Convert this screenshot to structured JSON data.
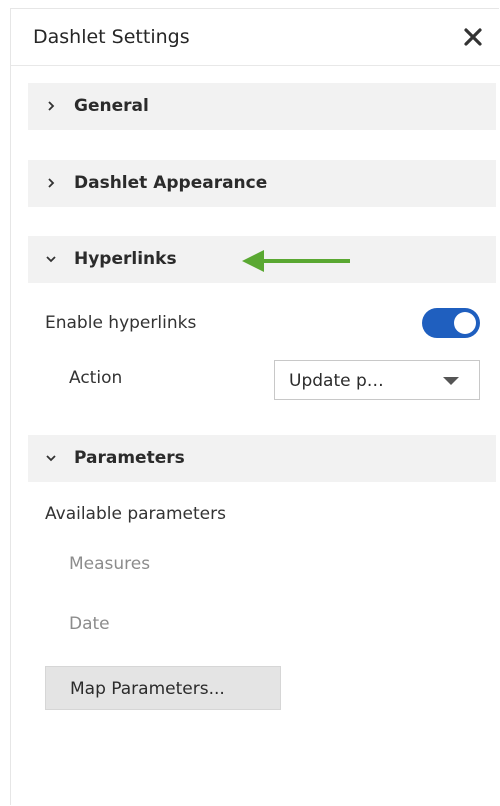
{
  "panel": {
    "title": "Dashlet Settings",
    "close_icon": "close-icon"
  },
  "sections": {
    "general": {
      "label": "General",
      "expanded": false
    },
    "appearance": {
      "label": "Dashlet Appearance",
      "expanded": false
    },
    "hyperlinks": {
      "label": "Hyperlinks",
      "expanded": true
    },
    "parameters": {
      "label": "Parameters",
      "expanded": true
    }
  },
  "hyperlinks": {
    "enable_label": "Enable hyperlinks",
    "enabled": true,
    "action_label": "Action",
    "action_value": "Update p…"
  },
  "parameters": {
    "available_label": "Available parameters",
    "items": [
      "Measures",
      "Date"
    ],
    "map_button_label": "Map Parameters..."
  },
  "colors": {
    "toggle_on": "#1f5fbf",
    "section_bg": "#f2f2f2",
    "annotation_arrow": "#5aa832"
  }
}
